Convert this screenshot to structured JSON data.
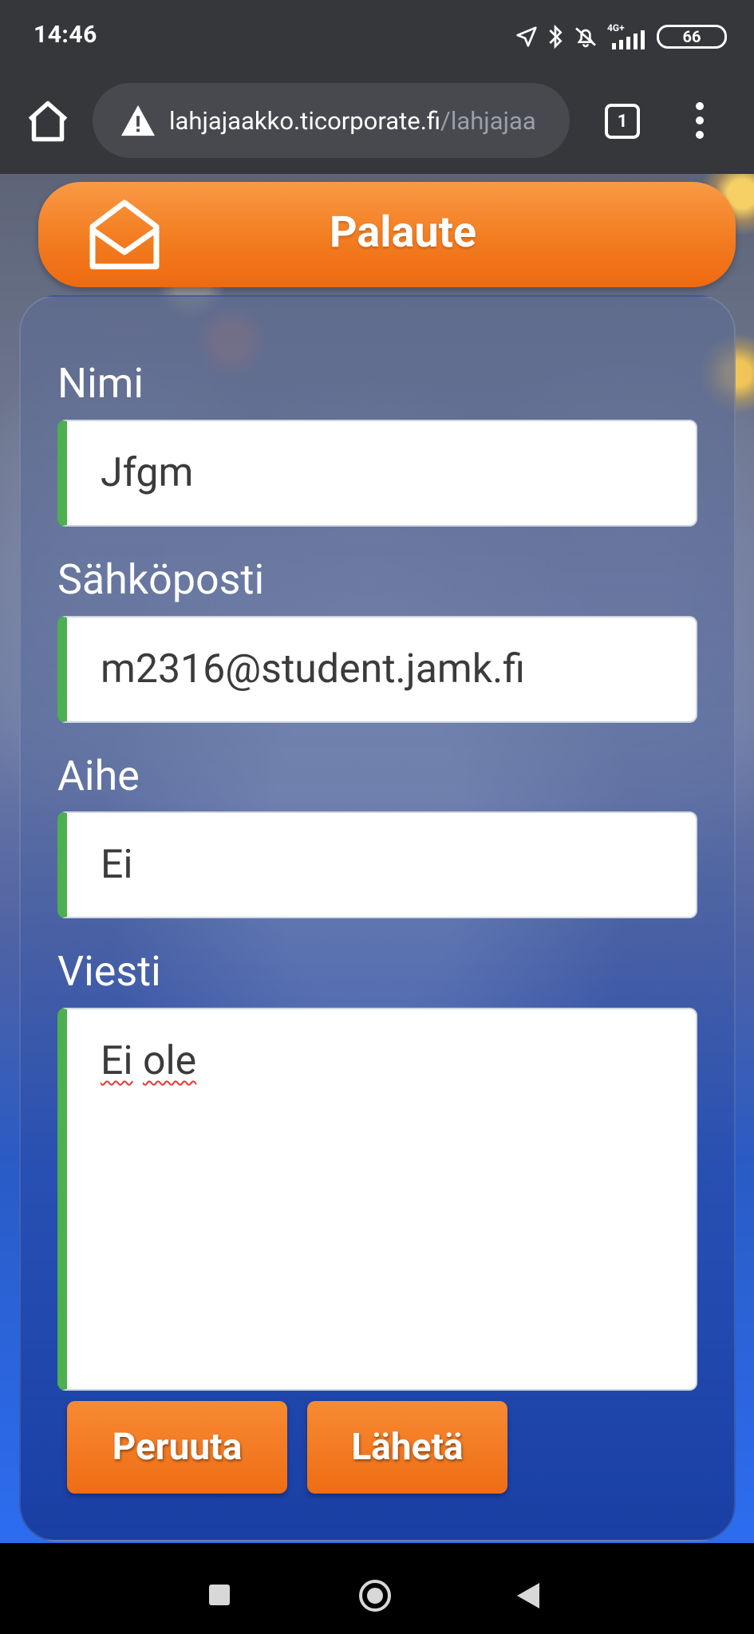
{
  "status_bar": {
    "time": "14:46",
    "network": "4G+",
    "battery": "66"
  },
  "browser": {
    "url_domain": "lahjajaakko.ticorporate.fi",
    "url_path": "/lahjajaa",
    "tab_count": "1"
  },
  "page": {
    "title": "Palaute"
  },
  "form": {
    "name_label": "Nimi",
    "name_value": "Jfgm",
    "email_label": "Sähköposti",
    "email_value": "m2316@student.jamk.fi",
    "subject_label": "Aihe",
    "subject_value": "Ei",
    "message_label": "Viesti",
    "message_words": [
      "Ei",
      "ole"
    ],
    "cancel_label": "Peruuta",
    "send_label": "Lähetä"
  },
  "colors": {
    "accent_orange": "#f37c20",
    "input_border_valid": "#4caf50",
    "spellcheck": "#e53935"
  }
}
